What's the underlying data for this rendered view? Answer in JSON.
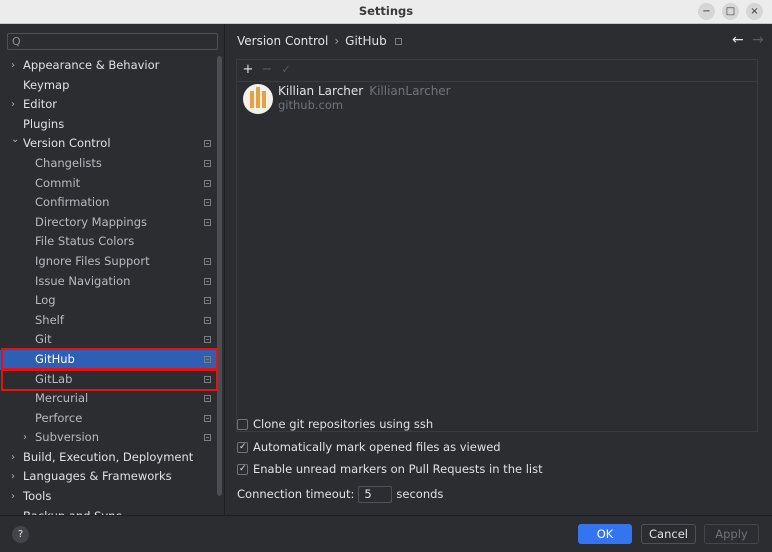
{
  "window": {
    "title": "Settings",
    "minimize_icon": "−",
    "maximize_icon": "□",
    "close_icon": "×"
  },
  "search": {
    "icon": "Q",
    "placeholder": ""
  },
  "tree": [
    {
      "label": "Appearance & Behavior",
      "expandable": true,
      "expanded": false,
      "level": 0,
      "pinned": false
    },
    {
      "label": "Keymap",
      "expandable": false,
      "level": 0,
      "pinned": false
    },
    {
      "label": "Editor",
      "expandable": true,
      "expanded": false,
      "level": 0,
      "pinned": false
    },
    {
      "label": "Plugins",
      "expandable": false,
      "level": 0,
      "pinned": false
    },
    {
      "label": "Version Control",
      "expandable": true,
      "expanded": true,
      "level": 0,
      "pinned": true
    },
    {
      "label": "Changelists",
      "expandable": false,
      "level": 1,
      "pinned": true
    },
    {
      "label": "Commit",
      "expandable": false,
      "level": 1,
      "pinned": true
    },
    {
      "label": "Confirmation",
      "expandable": false,
      "level": 1,
      "pinned": true
    },
    {
      "label": "Directory Mappings",
      "expandable": false,
      "level": 1,
      "pinned": true
    },
    {
      "label": "File Status Colors",
      "expandable": false,
      "level": 1,
      "pinned": false
    },
    {
      "label": "Ignore Files Support",
      "expandable": false,
      "level": 1,
      "pinned": true
    },
    {
      "label": "Issue Navigation",
      "expandable": false,
      "level": 1,
      "pinned": true
    },
    {
      "label": "Log",
      "expandable": false,
      "level": 1,
      "pinned": true
    },
    {
      "label": "Shelf",
      "expandable": false,
      "level": 1,
      "pinned": true
    },
    {
      "label": "Git",
      "expandable": false,
      "level": 1,
      "pinned": true
    },
    {
      "label": "GitHub",
      "expandable": false,
      "level": 1,
      "pinned": true,
      "selected": true
    },
    {
      "label": "GitLab",
      "expandable": false,
      "level": 1,
      "pinned": true
    },
    {
      "label": "Mercurial",
      "expandable": false,
      "level": 1,
      "pinned": true
    },
    {
      "label": "Perforce",
      "expandable": false,
      "level": 1,
      "pinned": true
    },
    {
      "label": "Subversion",
      "expandable": true,
      "expanded": false,
      "level": 1,
      "pinned": true
    },
    {
      "label": "Build, Execution, Deployment",
      "expandable": true,
      "expanded": false,
      "level": 0,
      "pinned": false
    },
    {
      "label": "Languages & Frameworks",
      "expandable": true,
      "expanded": false,
      "level": 0,
      "pinned": false
    },
    {
      "label": "Tools",
      "expandable": true,
      "expanded": false,
      "level": 0,
      "pinned": false
    },
    {
      "label": "Backup and Sync",
      "expandable": false,
      "level": 0,
      "pinned": false
    }
  ],
  "breadcrumb": {
    "parent": "Version Control",
    "separator": "›",
    "current": "GitHub",
    "back_icon": "←",
    "forward_icon": "→"
  },
  "toolbar": {
    "add_icon": "+",
    "remove_icon": "−",
    "default_icon": "✓"
  },
  "account": {
    "name": "Killian Larcher",
    "login": "KillianLarcher",
    "server": "github.com"
  },
  "options": {
    "clone_ssh": {
      "label": "Clone git repositories using ssh",
      "checked": false
    },
    "auto_mark_viewed": {
      "label": "Automatically mark opened files as viewed",
      "checked": true
    },
    "unread_markers": {
      "label": "Enable unread markers on Pull Requests in the list",
      "checked": true
    },
    "timeout": {
      "label": "Connection timeout:",
      "value": "5",
      "unit": "seconds"
    }
  },
  "footer": {
    "help_icon": "?",
    "ok_label": "OK",
    "cancel_label": "Cancel",
    "apply_label": "Apply"
  },
  "colors": {
    "selection": "#2e5fb5",
    "highlight": "#e01414",
    "primary_button": "#3574f0"
  }
}
